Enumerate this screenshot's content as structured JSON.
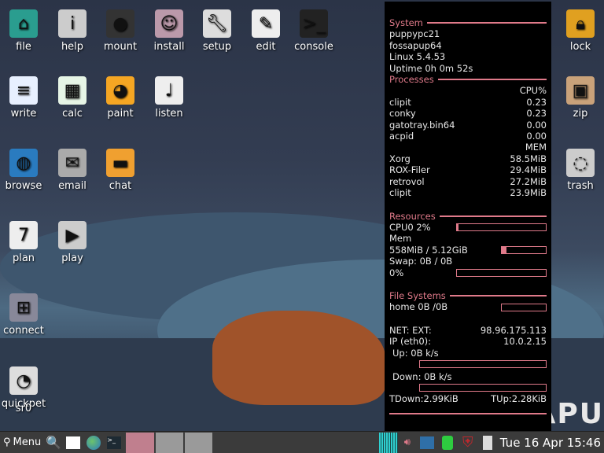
{
  "desktop": {
    "icons_left": [
      {
        "label": "file",
        "icon": "home-icon"
      },
      {
        "label": "help",
        "icon": "info-icon"
      },
      {
        "label": "mount",
        "icon": "drive-icon"
      },
      {
        "label": "install",
        "icon": "package-icon"
      },
      {
        "label": "setup",
        "icon": "wrench-icon"
      },
      {
        "label": "edit",
        "icon": "pencil-icon"
      },
      {
        "label": "console",
        "icon": "terminal-icon"
      },
      {
        "label": "write",
        "icon": "document-icon"
      },
      {
        "label": "calc",
        "icon": "spreadsheet-icon"
      },
      {
        "label": "paint",
        "icon": "palette-icon"
      },
      {
        "label": "listen",
        "icon": "music-note-icon"
      },
      {
        "label": "browse",
        "icon": "globe-icon"
      },
      {
        "label": "email",
        "icon": "envelope-icon"
      },
      {
        "label": "chat",
        "icon": "chat-icon"
      },
      {
        "label": "plan",
        "icon": "calendar-icon"
      },
      {
        "label": "play",
        "icon": "video-play-icon"
      },
      {
        "label": "connect",
        "icon": "network-icon"
      },
      {
        "label": "quickpet",
        "icon": "pet-icon"
      },
      {
        "label": "sr0",
        "icon": "optical-drive-icon"
      }
    ],
    "icons_right": [
      {
        "label": "lock",
        "icon": "lock-icon"
      },
      {
        "label": "zip",
        "icon": "archive-icon"
      },
      {
        "label": "trash",
        "icon": "trash-icon"
      }
    ],
    "calendar_day": "7",
    "wallpaper_text": "RAPU"
  },
  "conky": {
    "system_title": "System",
    "hostname": "puppypc21",
    "distro": "fossapup64",
    "kernel": "Linux 5.4.53",
    "uptime": "Uptime 0h 0m 52s",
    "processes_title": "Processes",
    "cpu_header": "CPU%",
    "cpu_procs": [
      {
        "name": "clipit",
        "value": "0.23"
      },
      {
        "name": "conky",
        "value": "0.23"
      },
      {
        "name": "gatotray.bin64",
        "value": "0.00"
      },
      {
        "name": "acpid",
        "value": "0.00"
      }
    ],
    "mem_header": "MEM",
    "mem_procs": [
      {
        "name": "Xorg",
        "value": "58.5MiB"
      },
      {
        "name": "ROX-Filer",
        "value": "29.4MiB"
      },
      {
        "name": "retrovol",
        "value": "27.2MiB"
      },
      {
        "name": "clipit",
        "value": "23.9MiB"
      }
    ],
    "resources_title": "Resources",
    "cpu0": "CPU0 2%",
    "cpu0_pct": 2,
    "mem_label": "Mem",
    "mem_value": "558MiB / 5.12GiB",
    "mem_pct": 10.6,
    "swap": "Swap: 0B   / 0B",
    "swap_pct_label": "0%",
    "swap_pct": 0,
    "fs_title": "File Systems",
    "home": "home 0B  /0B",
    "home_pct": 0,
    "net_ext_label": "NET: EXT:",
    "net_ext": "98.96.175.113",
    "ip_label": "IP (eth0):",
    "ip": "10.0.2.15",
    "up": "Up: 0B   k/s",
    "down": "Down: 0B  k/s",
    "tdown": "TDown:2.99KiB",
    "tup": "TUp:2.28KiB"
  },
  "taskbar": {
    "menu_label": "Menu",
    "clock": "Tue 16 Apr 15:46",
    "accent": "#c07f8e"
  }
}
